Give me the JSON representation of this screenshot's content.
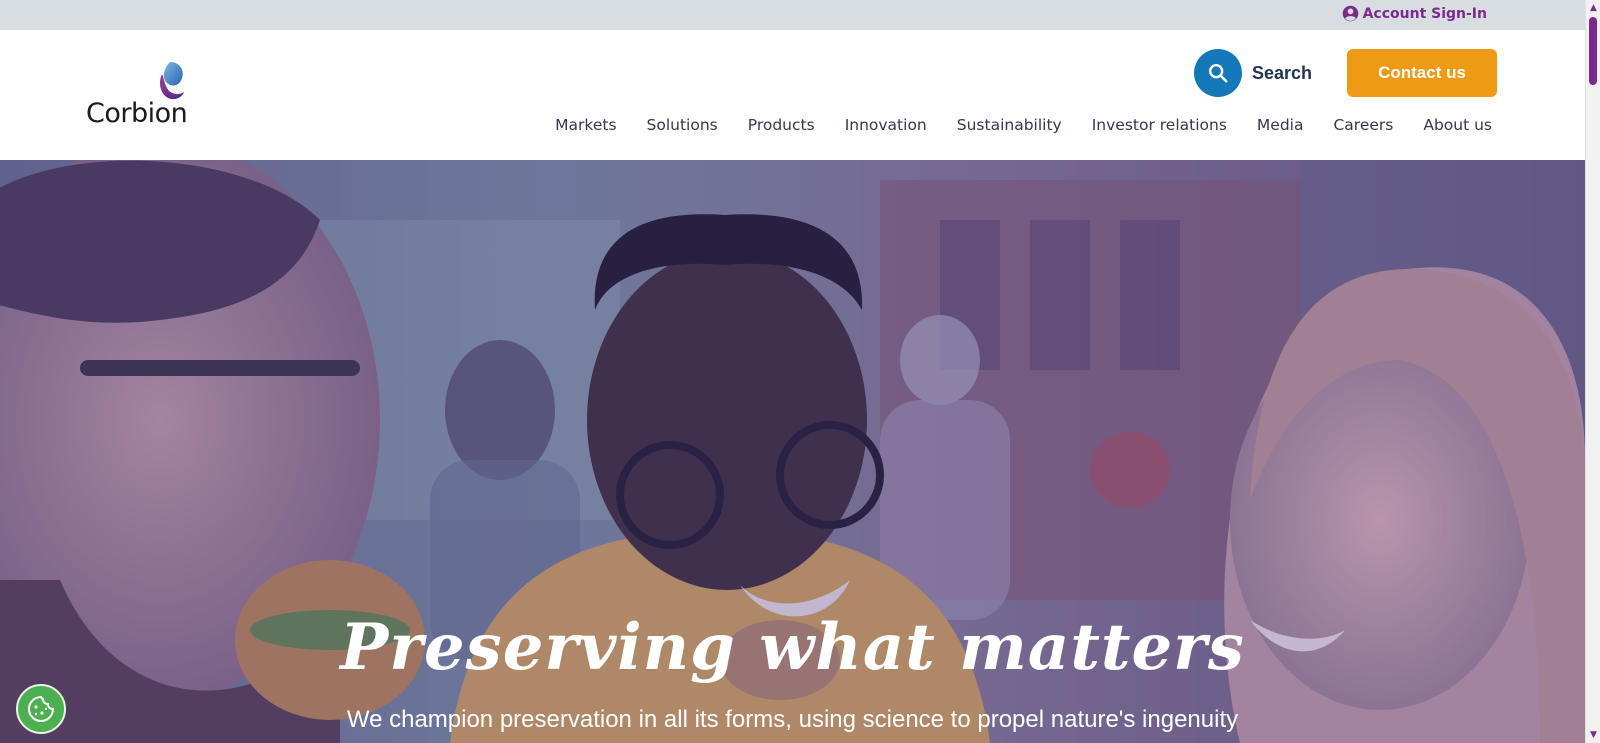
{
  "topbar": {
    "account_label": "Account Sign-In",
    "account_icon": "user-circle-icon"
  },
  "header": {
    "logo_text": "Corbion",
    "search_label": "Search",
    "contact_label": "Contact us",
    "nav": [
      {
        "label": "Markets"
      },
      {
        "label": "Solutions"
      },
      {
        "label": "Products"
      },
      {
        "label": "Innovation"
      },
      {
        "label": "Sustainability"
      },
      {
        "label": "Investor relations"
      },
      {
        "label": "Media"
      },
      {
        "label": "Careers"
      },
      {
        "label": "About us"
      }
    ]
  },
  "hero": {
    "title": "Preserving what matters",
    "subtitle": "We champion preservation in all its forms, using science to propel nature's ingenuity"
  },
  "colors": {
    "brand_purple": "#7b2a8c",
    "search_blue": "#1477b8",
    "contact_orange": "#ef9a14",
    "cookie_green": "#4caf50"
  }
}
